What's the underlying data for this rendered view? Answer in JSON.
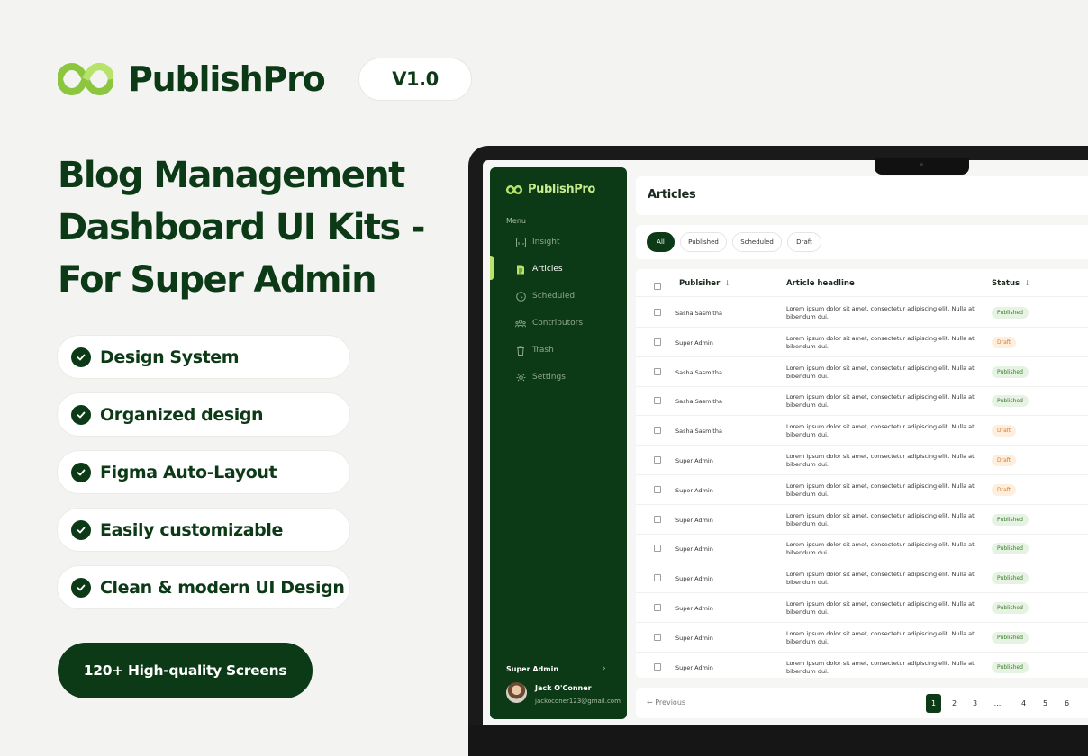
{
  "brand": {
    "name": "PublishPro",
    "version": "V1.0",
    "accent": "#b7e36a",
    "primary": "#0d3a16"
  },
  "headline": "Blog Management Dashboard UI Kits - For Super Admin",
  "features": [
    "Design System",
    "Organized design",
    "Figma Auto-Layout",
    "Easily customizable",
    "Clean & modern UI Design"
  ],
  "cta": "120+ High-quality Screens",
  "app": {
    "brand": "PublishPro",
    "menu_title": "Menu",
    "menu": [
      {
        "label": "Insight",
        "icon": "chart-icon"
      },
      {
        "label": "Articles",
        "icon": "document-icon"
      },
      {
        "label": "Scheduled",
        "icon": "clock-icon"
      },
      {
        "label": "Contributors",
        "icon": "users-icon"
      },
      {
        "label": "Trash",
        "icon": "trash-icon"
      },
      {
        "label": "Settings",
        "icon": "gear-icon"
      }
    ],
    "active_menu": "Articles",
    "role": "Super Admin",
    "user": {
      "name": "Jack O'Conner",
      "email": "jackoconer123@gmail.com"
    },
    "page_title": "Articles",
    "filters": [
      "All",
      "Published",
      "Scheduled",
      "Draft"
    ],
    "active_filter": "All",
    "table": {
      "columns": [
        "Publsiher",
        "Article headline",
        "Status"
      ],
      "rows": [
        {
          "publisher": "Sasha Sasmitha",
          "headline": "Lorem ipsum dolor sit amet, consectetur adipiscing elit. Nulla at bibendum dui.",
          "status": "Published"
        },
        {
          "publisher": "Super Admin",
          "headline": "Lorem ipsum dolor sit amet, consectetur adipiscing elit. Nulla at bibendum dui.",
          "status": "Draft"
        },
        {
          "publisher": "Sasha Sasmitha",
          "headline": "Lorem ipsum dolor sit amet, consectetur adipiscing elit. Nulla at bibendum dui.",
          "status": "Published"
        },
        {
          "publisher": "Sasha Sasmitha",
          "headline": "Lorem ipsum dolor sit amet, consectetur adipiscing elit. Nulla at bibendum dui.",
          "status": "Published"
        },
        {
          "publisher": "Sasha Sasmitha",
          "headline": "Lorem ipsum dolor sit amet, consectetur adipiscing elit. Nulla at bibendum dui.",
          "status": "Draft"
        },
        {
          "publisher": "Super Admin",
          "headline": "Lorem ipsum dolor sit amet, consectetur adipiscing elit. Nulla at bibendum dui.",
          "status": "Draft"
        },
        {
          "publisher": "Super Admin",
          "headline": "Lorem ipsum dolor sit amet, consectetur adipiscing elit. Nulla at bibendum dui.",
          "status": "Draft"
        },
        {
          "publisher": "Super Admin",
          "headline": "Lorem ipsum dolor sit amet, consectetur adipiscing elit. Nulla at bibendum dui.",
          "status": "Published"
        },
        {
          "publisher": "Super Admin",
          "headline": "Lorem ipsum dolor sit amet, consectetur adipiscing elit. Nulla at bibendum dui.",
          "status": "Published"
        },
        {
          "publisher": "Super Admin",
          "headline": "Lorem ipsum dolor sit amet, consectetur adipiscing elit. Nulla at bibendum dui.",
          "status": "Published"
        },
        {
          "publisher": "Super Admin",
          "headline": "Lorem ipsum dolor sit amet, consectetur adipiscing elit. Nulla at bibendum dui.",
          "status": "Published"
        },
        {
          "publisher": "Super Admin",
          "headline": "Lorem ipsum dolor sit amet, consectetur adipiscing elit. Nulla at bibendum dui.",
          "status": "Published"
        },
        {
          "publisher": "Super Admin",
          "headline": "Lorem ipsum dolor sit amet, consectetur adipiscing elit. Nulla at bibendum dui.",
          "status": "Published"
        }
      ]
    },
    "pagination": {
      "previous": "Previous",
      "pages": [
        "1",
        "2",
        "3",
        "...",
        "4",
        "5",
        "6"
      ],
      "active": "1"
    }
  }
}
